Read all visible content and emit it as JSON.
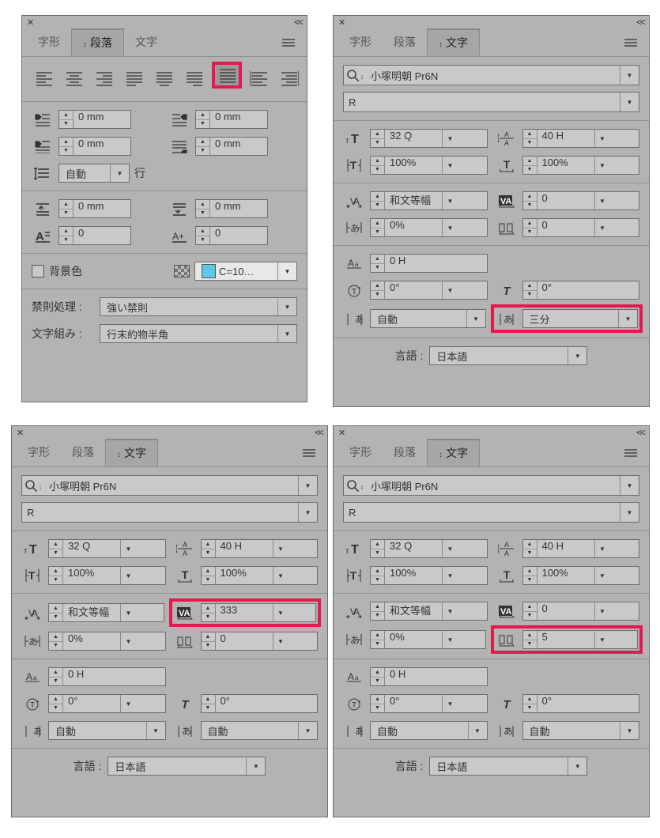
{
  "panel_para": {
    "tabs": [
      "字形",
      "段落",
      "文字"
    ],
    "active_tab": 1,
    "indent_left": "0 mm",
    "indent_right": "0 mm",
    "indent_first": "0 mm",
    "indent_last": "0 mm",
    "line_spacing": "自動",
    "line_unit": "行",
    "space_before": "0 mm",
    "space_after": "0 mm",
    "drop_cap_lines": "0",
    "drop_cap_chars": "0",
    "shading_label": "背景色",
    "shading_color": "C=10…",
    "kinsoku_label": "禁則処理 :",
    "kinsoku_value": "強い禁則",
    "mojikumi_label": "文字組み :",
    "mojikumi_value": "行末約物半角"
  },
  "panel_char_a": {
    "tabs": [
      "字形",
      "段落",
      "文字"
    ],
    "active_tab": 2,
    "font_family": "小塚明朝 Pr6N",
    "font_style": "R",
    "size": "32 Q",
    "leading": "40 H",
    "vscale": "100%",
    "hscale": "100%",
    "kerning": "和文等幅",
    "tracking": "0",
    "tsume": "0%",
    "grid_tracking": "0",
    "baseline_shift": "0 H",
    "char_rotation": "0°",
    "skew": "0°",
    "aki_before": "自動",
    "aki_after": "三分",
    "language_label": "言語 :",
    "language": "日本語"
  },
  "panel_char_b": {
    "tabs": [
      "字形",
      "段落",
      "文字"
    ],
    "active_tab": 2,
    "font_family": "小塚明朝 Pr6N",
    "font_style": "R",
    "size": "32 Q",
    "leading": "40 H",
    "vscale": "100%",
    "hscale": "100%",
    "kerning": "和文等幅",
    "tracking": "333",
    "tsume": "0%",
    "grid_tracking": "0",
    "baseline_shift": "0 H",
    "char_rotation": "0°",
    "skew": "0°",
    "aki_before": "自動",
    "aki_after": "自動",
    "language_label": "言語 :",
    "language": "日本語"
  },
  "panel_char_c": {
    "tabs": [
      "字形",
      "段落",
      "文字"
    ],
    "active_tab": 2,
    "font_family": "小塚明朝 Pr6N",
    "font_style": "R",
    "size": "32 Q",
    "leading": "40 H",
    "vscale": "100%",
    "hscale": "100%",
    "kerning": "和文等幅",
    "tracking": "0",
    "tsume": "0%",
    "grid_tracking": "5",
    "baseline_shift": "0 H",
    "char_rotation": "0°",
    "skew": "0°",
    "aki_before": "自動",
    "aki_after": "自動",
    "language_label": "言語 :",
    "language": "日本語"
  }
}
